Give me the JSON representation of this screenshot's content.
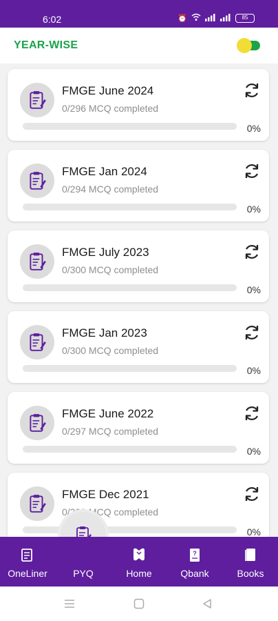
{
  "status_bar": {
    "time": "6:02",
    "battery": "85"
  },
  "header": {
    "title": "YEAR-WISE",
    "toggle_on": true
  },
  "colors": {
    "brand_purple": "#5e1e9e",
    "accent_green": "#1aa34a",
    "toggle_yellow": "#f2dd36"
  },
  "papers": [
    {
      "title": "FMGE June 2024",
      "progress_text": "0/296 MCQ completed",
      "percent_label": "0%",
      "percent": 0
    },
    {
      "title": "FMGE Jan 2024",
      "progress_text": "0/294 MCQ completed",
      "percent_label": "0%",
      "percent": 0
    },
    {
      "title": "FMGE July 2023",
      "progress_text": "0/300 MCQ completed",
      "percent_label": "0%",
      "percent": 0
    },
    {
      "title": "FMGE Jan 2023",
      "progress_text": "0/300 MCQ completed",
      "percent_label": "0%",
      "percent": 0
    },
    {
      "title": "FMGE June 2022",
      "progress_text": "0/297 MCQ completed",
      "percent_label": "0%",
      "percent": 0
    },
    {
      "title": "FMGE Dec 2021",
      "progress_text": "0/300 MCQ completed",
      "percent_label": "0%",
      "percent": 0
    }
  ],
  "bottom_nav": [
    {
      "label": "OneLiner",
      "icon": "oneliner-icon"
    },
    {
      "label": "PYQ",
      "icon": "pyq-icon",
      "active": true
    },
    {
      "label": "Home",
      "icon": "home-icon"
    },
    {
      "label": "Qbank",
      "icon": "qbank-icon"
    },
    {
      "label": "Books",
      "icon": "books-icon"
    }
  ]
}
